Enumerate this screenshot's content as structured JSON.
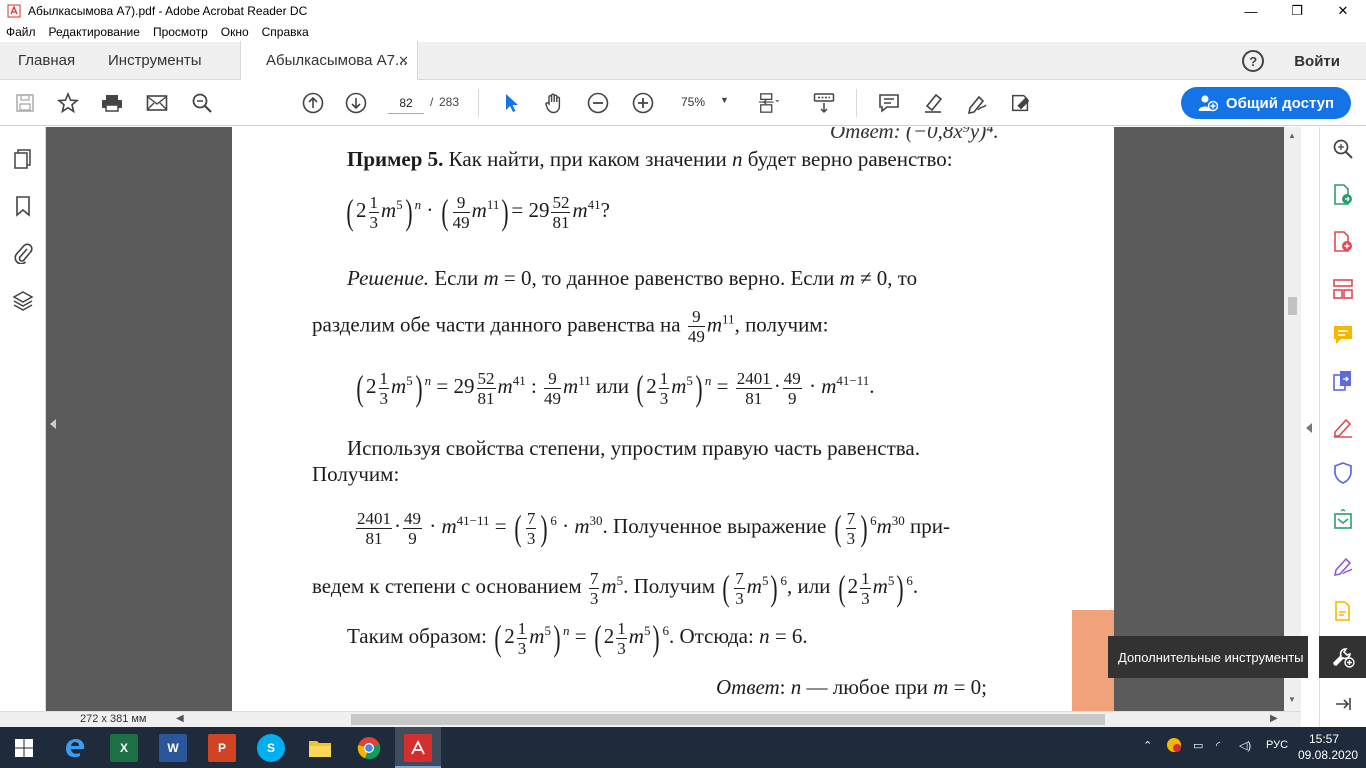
{
  "window": {
    "title": "Абылкасымова А7).pdf - Adobe Acrobat Reader DC",
    "minimize": "—",
    "restore": "❐",
    "close": "✕"
  },
  "menu": [
    "Файл",
    "Редактирование",
    "Просмотр",
    "Окно",
    "Справка"
  ],
  "tabs": {
    "home": "Главная",
    "tools": "Инструменты",
    "doc": "Абылкасымова А7...",
    "doc_close": "✕",
    "help": "?",
    "signin": "Войти"
  },
  "toolbar": {
    "current_page": "82",
    "page_sep": "/",
    "total_pages": "283",
    "zoom": "75%",
    "share_label": "Общий доступ"
  },
  "document": {
    "top_cut": "Ответ: (−0,8x⁹y)⁴.",
    "example_title": "Пример 5.",
    "example_text": "Как найти, при каком значении",
    "example_text2": "будет верно равенство:",
    "var_n": "n",
    "var_m": "m",
    "solution_label": "Решение.",
    "solution_text": "Если",
    "eq_zero": "= 0, то данное равенство верно. Если",
    "neq_zero": "≠ 0, то",
    "divide_text": "разделим обе части данного равенства на",
    "get_text": ", получим:",
    "or_text": "или",
    "using_text": "Используя свойства степени, упростим правую часть равенства.",
    "get2": "Получим:",
    "obtained_expr": ". Полученное выражение",
    "pri": "при-",
    "reduce_text": "ведем к степени с основанием",
    "get3": ". Получим",
    "or2": ", или",
    "thus_text": "Таким образом:",
    "hence": ". Отсюда:",
    "n_eq_6": "= 6.",
    "answer_label": "Ответ",
    "answer_text": "— любое при",
    "m_eq_0": "= 0;"
  },
  "tooltip": "Дополнительные инструменты",
  "status": {
    "dimensions": "272 x 381 мм"
  },
  "taskbar": {
    "lang": "РУС",
    "time": "15:57",
    "date": "09.08.2020"
  },
  "colors": {
    "accent": "#1473e6",
    "taskbar": "#1f2b3a",
    "doc_bg": "#5b5b5b"
  }
}
